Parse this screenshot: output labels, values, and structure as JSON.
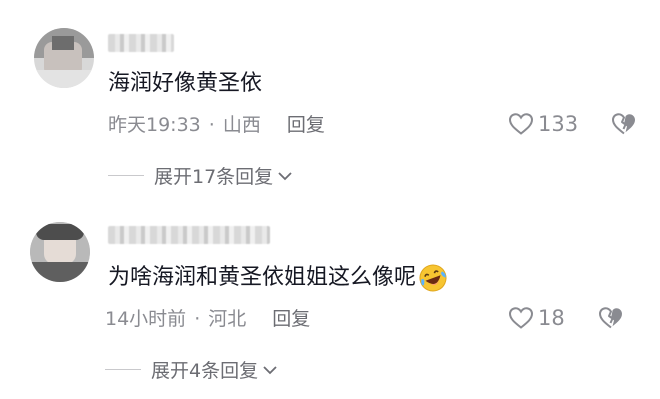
{
  "comments": [
    {
      "text": "海润好像黄圣依",
      "time": "昨天19:33",
      "location": "山西",
      "reply_label": "回复",
      "likes": "133",
      "expand_label": "展开17条回复"
    },
    {
      "text": "为啥海润和黄圣依姐姐这么像呢",
      "time": "14小时前",
      "location": "河北",
      "reply_label": "回复",
      "likes": "18",
      "expand_label": "展开4条回复"
    }
  ],
  "separator": "·",
  "icons": {
    "like": "heart-outline-icon",
    "dislike": "broken-heart-icon",
    "expand": "chevron-down-icon",
    "emoji": "laughing-tears-emoji-icon"
  },
  "colors": {
    "text_primary": "#161823",
    "text_secondary": "#8a8b91",
    "emoji_face": "#f7c531"
  }
}
